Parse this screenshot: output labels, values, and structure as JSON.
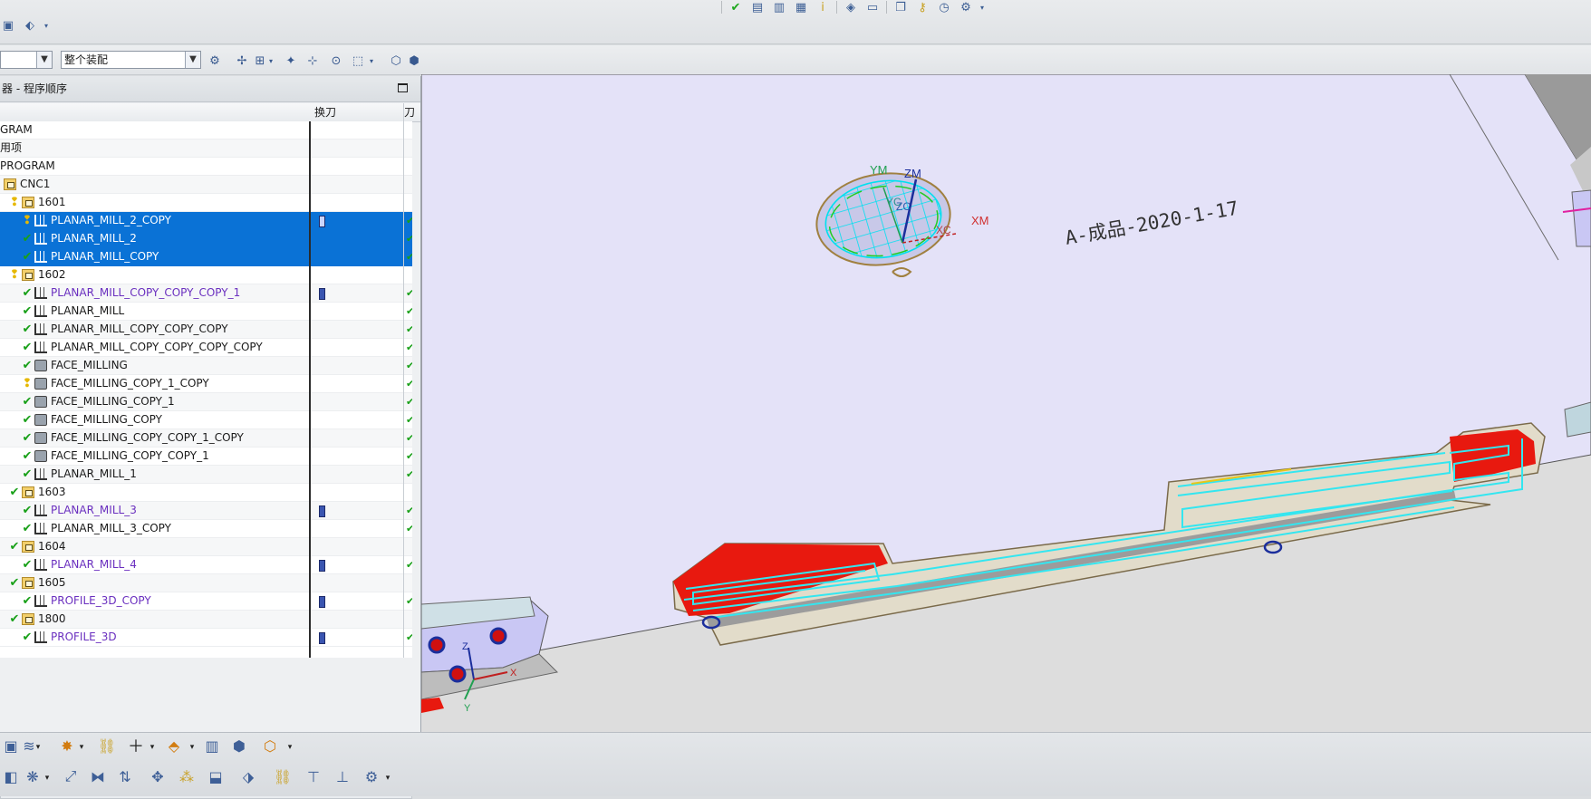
{
  "toolbar": {
    "assembly_filter": "整个装配"
  },
  "navigator": {
    "title": "器 - 程序顺序",
    "columns": {
      "name": "",
      "tool_change": "换刀",
      "path": "刀"
    }
  },
  "tree": [
    {
      "label": "GRAM",
      "indent": 0,
      "icon": "none",
      "status": "none",
      "toolchange": false,
      "selected": false,
      "purple": false
    },
    {
      "label": "用项",
      "indent": 0,
      "icon": "none",
      "status": "none",
      "toolchange": false,
      "selected": false,
      "purple": false
    },
    {
      "label": "PROGRAM",
      "indent": 0,
      "icon": "none",
      "status": "none",
      "toolchange": false,
      "selected": false,
      "purple": false
    },
    {
      "label": "CNC1",
      "indent": 1,
      "icon": "folder",
      "status": "none",
      "toolchange": false,
      "selected": false,
      "purple": false
    },
    {
      "label": "1601",
      "indent": 2,
      "icon": "folder",
      "status": "bulb",
      "toolchange": false,
      "selected": false,
      "purple": false
    },
    {
      "label": "PLANAR_MILL_2_COPY",
      "indent": 3,
      "icon": "mill",
      "status": "bulb",
      "toolchange": true,
      "selected": true,
      "purple": false
    },
    {
      "label": "PLANAR_MILL_2",
      "indent": 3,
      "icon": "mill",
      "status": "check",
      "toolchange": false,
      "selected": true,
      "purple": false
    },
    {
      "label": "PLANAR_MILL_COPY",
      "indent": 3,
      "icon": "mill",
      "status": "check",
      "toolchange": false,
      "selected": true,
      "purple": false
    },
    {
      "label": "1602",
      "indent": 2,
      "icon": "folder",
      "status": "bulb",
      "toolchange": false,
      "selected": false,
      "purple": false
    },
    {
      "label": "PLANAR_MILL_COPY_COPY_COPY_1",
      "indent": 3,
      "icon": "mill",
      "status": "check",
      "toolchange": true,
      "selected": false,
      "purple": true
    },
    {
      "label": "PLANAR_MILL",
      "indent": 3,
      "icon": "mill",
      "status": "check",
      "toolchange": false,
      "selected": false,
      "purple": false
    },
    {
      "label": "PLANAR_MILL_COPY_COPY_COPY",
      "indent": 3,
      "icon": "mill",
      "status": "check",
      "toolchange": false,
      "selected": false,
      "purple": false
    },
    {
      "label": "PLANAR_MILL_COPY_COPY_COPY_COPY",
      "indent": 3,
      "icon": "mill",
      "status": "check",
      "toolchange": false,
      "selected": false,
      "purple": false
    },
    {
      "label": "FACE_MILLING",
      "indent": 3,
      "icon": "face",
      "status": "check",
      "toolchange": false,
      "selected": false,
      "purple": false
    },
    {
      "label": "FACE_MILLING_COPY_1_COPY",
      "indent": 3,
      "icon": "face",
      "status": "bulb",
      "toolchange": false,
      "selected": false,
      "purple": false
    },
    {
      "label": "FACE_MILLING_COPY_1",
      "indent": 3,
      "icon": "face",
      "status": "check",
      "toolchange": false,
      "selected": false,
      "purple": false
    },
    {
      "label": "FACE_MILLING_COPY",
      "indent": 3,
      "icon": "face",
      "status": "check",
      "toolchange": false,
      "selected": false,
      "purple": false
    },
    {
      "label": "FACE_MILLING_COPY_COPY_1_COPY",
      "indent": 3,
      "icon": "face",
      "status": "check",
      "toolchange": false,
      "selected": false,
      "purple": false
    },
    {
      "label": "FACE_MILLING_COPY_COPY_1",
      "indent": 3,
      "icon": "face",
      "status": "check",
      "toolchange": false,
      "selected": false,
      "purple": false
    },
    {
      "label": "PLANAR_MILL_1",
      "indent": 3,
      "icon": "mill",
      "status": "check",
      "toolchange": false,
      "selected": false,
      "purple": false
    },
    {
      "label": "1603",
      "indent": 2,
      "icon": "folder",
      "status": "check",
      "toolchange": false,
      "selected": false,
      "purple": false
    },
    {
      "label": "PLANAR_MILL_3",
      "indent": 3,
      "icon": "mill",
      "status": "check",
      "toolchange": true,
      "selected": false,
      "purple": true
    },
    {
      "label": "PLANAR_MILL_3_COPY",
      "indent": 3,
      "icon": "mill",
      "status": "check",
      "toolchange": false,
      "selected": false,
      "purple": false
    },
    {
      "label": "1604",
      "indent": 2,
      "icon": "folder",
      "status": "check",
      "toolchange": false,
      "selected": false,
      "purple": false
    },
    {
      "label": "PLANAR_MILL_4",
      "indent": 3,
      "icon": "mill",
      "status": "check",
      "toolchange": true,
      "selected": false,
      "purple": true
    },
    {
      "label": "1605",
      "indent": 2,
      "icon": "folder",
      "status": "check",
      "toolchange": false,
      "selected": false,
      "purple": false
    },
    {
      "label": "PROFILE_3D_COPY",
      "indent": 3,
      "icon": "mill",
      "status": "check",
      "toolchange": true,
      "selected": false,
      "purple": true
    },
    {
      "label": "1800",
      "indent": 2,
      "icon": "folder",
      "status": "check",
      "toolchange": false,
      "selected": false,
      "purple": false
    },
    {
      "label": "PROFILE_3D",
      "indent": 3,
      "icon": "mill",
      "status": "check",
      "toolchange": true,
      "selected": false,
      "purple": true
    }
  ],
  "viewport": {
    "part_label": "A-成品-2020-1-17",
    "axis_labels": {
      "ym": "YM",
      "zm": "ZM",
      "xm": "XM",
      "yc": "YC",
      "zc": "ZC",
      "xc": "XC",
      "z": "Z",
      "x": "X",
      "y": "Y"
    },
    "colors": {
      "plate": "#e4e2f8",
      "toolpath": "#33e6f0",
      "cut_region": "#e8190f",
      "background": "#dddddd"
    }
  },
  "colors": {
    "selection": "#0a72d6",
    "check": "#18a018",
    "purple_op": "#6a2fbf"
  }
}
